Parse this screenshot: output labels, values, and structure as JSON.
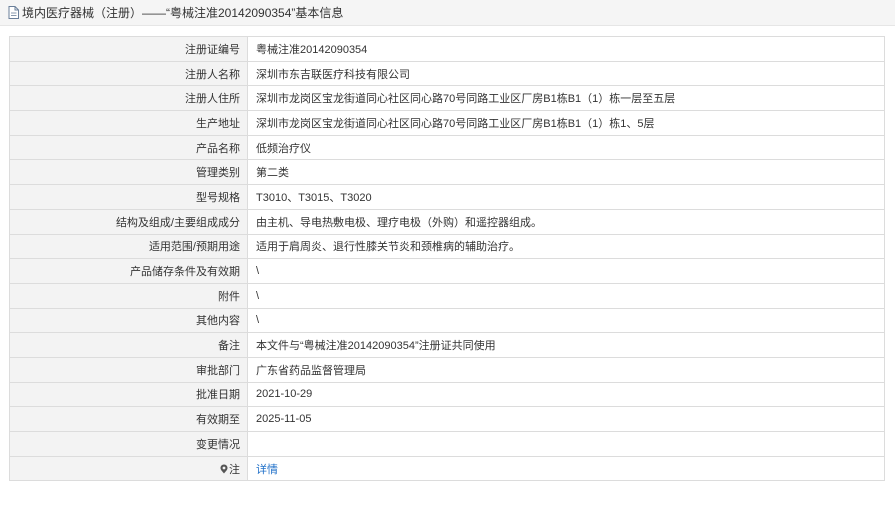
{
  "header": {
    "title": "境内医疗器械（注册）——“粤械注准20142090354”基本信息"
  },
  "rows": [
    {
      "label": "注册证编号",
      "value": "粤械注准20142090354"
    },
    {
      "label": "注册人名称",
      "value": "深圳市东吉联医疗科技有限公司"
    },
    {
      "label": "注册人住所",
      "value": "深圳市龙岗区宝龙街道同心社区同心路70号同路工业区厂房B1栋B1（1）栋一层至五层"
    },
    {
      "label": "生产地址",
      "value": "深圳市龙岗区宝龙街道同心社区同心路70号同路工业区厂房B1栋B1（1）栋1、5层"
    },
    {
      "label": "产品名称",
      "value": "低频治疗仪"
    },
    {
      "label": "管理类别",
      "value": "第二类"
    },
    {
      "label": "型号规格",
      "value": "T3010、T3015、T3020"
    },
    {
      "label": "结构及组成/主要组成成分",
      "value": "由主机、导电热敷电极、理疗电极（外购）和遥控器组成。"
    },
    {
      "label": "适用范围/预期用途",
      "value": "适用于肩周炎、退行性膝关节炎和颈椎病的辅助治疗。"
    },
    {
      "label": "产品储存条件及有效期",
      "value": "\\"
    },
    {
      "label": "附件",
      "value": "\\"
    },
    {
      "label": "其他内容",
      "value": "\\"
    },
    {
      "label": "备注",
      "value": "本文件与“粤械注准20142090354”注册证共同使用"
    },
    {
      "label": "审批部门",
      "value": "广东省药品监督管理局"
    },
    {
      "label": "批准日期",
      "value": "2021-10-29"
    },
    {
      "label": "有效期至",
      "value": "2025-11-05"
    },
    {
      "label": "变更情况",
      "value": ""
    }
  ],
  "note_row": {
    "label": "注",
    "icon": "pin-icon",
    "link_text": "详情"
  },
  "colors": {
    "link": "#1e6fc8",
    "label_bg": "#f3f3f3",
    "border": "#dcdcdc",
    "header_bg": "#f5f5f5"
  }
}
